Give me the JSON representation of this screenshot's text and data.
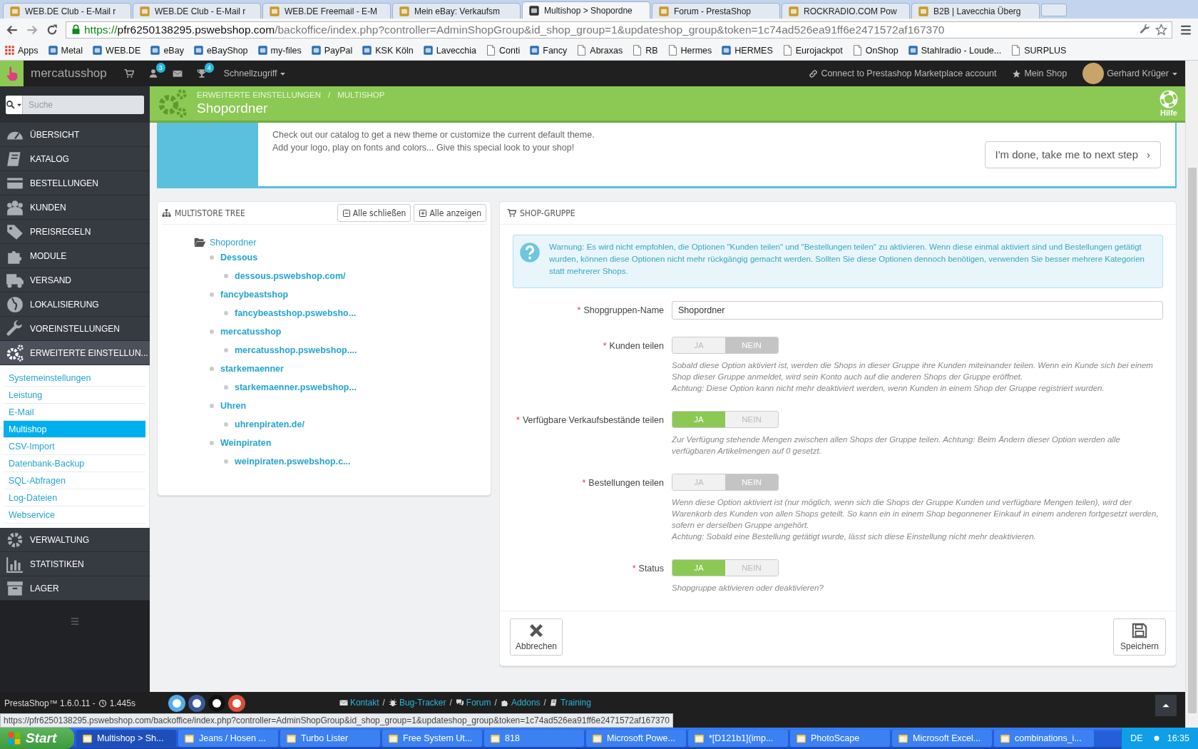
{
  "browser": {
    "tabs": [
      {
        "title": "WEB.DE Club - E-Mail r",
        "selected": false
      },
      {
        "title": "WEB.DE Club - E-Mail r",
        "selected": false
      },
      {
        "title": "WEB.DE Freemail - E-M",
        "selected": false
      },
      {
        "title": "Mein eBay: Verkaufsm",
        "selected": false
      },
      {
        "title": "Multishop > Shopordne",
        "selected": true
      },
      {
        "title": "Forum - PrestaShop",
        "selected": false
      },
      {
        "title": "ROCKRADIO.COM Pow",
        "selected": false
      },
      {
        "title": "B2B | Lavecchia Überg",
        "selected": false
      }
    ],
    "url": {
      "scheme": "https://",
      "host": "pfr6250138295.pswebshop.com",
      "path": "/backoffice/index.php?controller=AdminShopGroup&id_shop_group=1&updateshop_group&token=1c74ad526ea91ff6e2471572af167370"
    },
    "bookmarks": [
      {
        "label": "Apps",
        "kind": "apps"
      },
      {
        "label": "Metal",
        "kind": "site"
      },
      {
        "label": "WEB.DE",
        "kind": "site"
      },
      {
        "label": "eBay",
        "kind": "site"
      },
      {
        "label": "eBayShop",
        "kind": "site"
      },
      {
        "label": "my-files",
        "kind": "site"
      },
      {
        "label": "PayPal",
        "kind": "site"
      },
      {
        "label": "KSK Köln",
        "kind": "site"
      },
      {
        "label": "Lavecchia",
        "kind": "site"
      },
      {
        "label": "Conti",
        "kind": "page"
      },
      {
        "label": "Fancy",
        "kind": "site"
      },
      {
        "label": "Abraxas",
        "kind": "page"
      },
      {
        "label": "RB",
        "kind": "page"
      },
      {
        "label": "Hermes",
        "kind": "page"
      },
      {
        "label": "HERMES",
        "kind": "site"
      },
      {
        "label": "Eurojackpot",
        "kind": "page"
      },
      {
        "label": "OnShop",
        "kind": "page"
      },
      {
        "label": "Stahlradio - Loude...",
        "kind": "site"
      },
      {
        "label": "SURPLUS",
        "kind": "page"
      }
    ]
  },
  "admin_header": {
    "shop_name": "mercatusshop",
    "shortcuts": [
      {
        "kind": "cart"
      },
      {
        "kind": "user",
        "badge": "3"
      },
      {
        "kind": "envelope"
      },
      {
        "kind": "trophy",
        "badge": "4"
      }
    ],
    "quick_access": "Schnellzugriff",
    "marketplace": "Connect to Prestashop Marketplace account",
    "my_shop": "Mein Shop",
    "user": "Gerhard Krüger"
  },
  "page_header": {
    "breadcrumbs": [
      "ERWEITERTE EINSTELLUNGEN",
      "MULTISHOP"
    ],
    "separator": "/",
    "title": "Shopordner",
    "help": "Hilfe"
  },
  "sidebar": {
    "search_placeholder": "Suche",
    "items": [
      {
        "label": "ÜBERSICHT",
        "expanded": false
      },
      {
        "label": "KATALOG",
        "expanded": false
      },
      {
        "label": "BESTELLUNGEN",
        "expanded": false
      },
      {
        "label": "KUNDEN",
        "expanded": false
      },
      {
        "label": "PREISREGELN",
        "expanded": false
      },
      {
        "label": "MODULE",
        "expanded": false
      },
      {
        "label": "VERSAND",
        "expanded": false
      },
      {
        "label": "LOKALISIERUNG",
        "expanded": false
      },
      {
        "label": "VOREINSTELLUNGEN",
        "expanded": false
      },
      {
        "label": "ERWEITERTE EINSTELLUN...",
        "expanded": true,
        "children": [
          {
            "label": "Systemeinstellungen",
            "selected": false
          },
          {
            "label": "Leistung",
            "selected": false
          },
          {
            "label": "E-Mail",
            "selected": false
          },
          {
            "label": "Multishop",
            "selected": true
          },
          {
            "label": "CSV-Import",
            "selected": false
          },
          {
            "label": "Datenbank-Backup",
            "selected": false
          },
          {
            "label": "SQL-Abfragen",
            "selected": false
          },
          {
            "label": "Log-Dateien",
            "selected": false
          },
          {
            "label": "Webservice",
            "selected": false
          }
        ]
      },
      {
        "label": "VERWALTUNG",
        "expanded": false
      },
      {
        "label": "STATISTIKEN",
        "expanded": false
      },
      {
        "label": "LAGER",
        "expanded": false
      }
    ]
  },
  "onboarding": {
    "lines": [
      "Check out our catalog to get a new theme or customize the current default theme.",
      "Add your logo, play on fonts and colors... Give this special look to your shop!"
    ],
    "button": "I'm done, take me to next step",
    "button_arrow": "›"
  },
  "tree_panel": {
    "title": "MULTISTORE TREE",
    "buttons": [
      {
        "label": "Alle schließen"
      },
      {
        "label": "Alle anzeigen"
      }
    ],
    "root": {
      "label": "Shopordner",
      "children": [
        {
          "label": "Dessous",
          "children": [
            {
              "label": "dessous.pswebshop.com/"
            }
          ]
        },
        {
          "label": "fancybeastshop",
          "children": [
            {
              "label": "fancybeastshop.pswebsho..."
            }
          ]
        },
        {
          "label": "mercatusshop",
          "children": [
            {
              "label": "mercatusshop.pswebshop...."
            }
          ]
        },
        {
          "label": "starkemaenner",
          "children": [
            {
              "label": "starkemaenner.pswebshop..."
            }
          ]
        },
        {
          "label": "Uhren",
          "children": [
            {
              "label": "uhrenpiraten.de/"
            }
          ]
        },
        {
          "label": "Weinpiraten",
          "children": [
            {
              "label": "weinpiraten.pswebshop.c..."
            }
          ]
        }
      ]
    }
  },
  "form_panel": {
    "title": "SHOP-GRUPPE",
    "warning": "Warnung: Es wird nicht empfohlen, die Optionen \"Kunden teilen\" und \"Bestellungen teilen\" zu aktivieren. Wenn diese einmal aktiviert sind und Bestellungen getätigt wurden, können diese Optionen nicht mehr rückgängig gemacht werden. Sollten Sie diese Optionen dennoch benötigen, verwenden Sie besser mehrere Kategorien statt mehrerer Shops.",
    "fields": [
      {
        "kind": "text",
        "label": "Shopgruppen-Name",
        "required": true,
        "value": "Shopordner"
      },
      {
        "kind": "toggle",
        "label": "Kunden teilen",
        "required": true,
        "on": false,
        "yes": "JA",
        "no": "NEIN",
        "help": [
          "Sobald diese Option aktiviert ist, werden die Shops in dieser Gruppe ihre Kunden miteinander teilen. Wenn ein Kunde sich bei einem Shop dieser Gruppe anmeldet, wird sein Konto auch auf die anderen Shops der Gruppe eröffnet.",
          "Achtung: Diese Option kann nicht mehr deaktiviert werden, wenn Kunden in einem Shop der Gruppe registriert wurden."
        ]
      },
      {
        "kind": "toggle",
        "label": "Verfügbare Verkaufsbestände teilen",
        "required": true,
        "on": true,
        "yes": "JA",
        "no": "NEIN",
        "help": [
          "Zur Verfügung stehende Mengen zwischen allen Shops der Gruppe teilen. Achtung: Beim Ändern dieser Option werden alle verfügbaren Artikelmengen auf 0 gesetzt."
        ]
      },
      {
        "kind": "toggle",
        "label": "Bestellungen teilen",
        "required": true,
        "on": false,
        "yes": "JA",
        "no": "NEIN",
        "help": [
          "Wenn diese Option aktiviert ist (nur möglich, wenn sich die Shops der Gruppe Kunden und verfügbare Mengen teilen), wird der Warenkorb des Kunden von allen Shops geteilt. So kann ein in einem Shop begonnener Einkauf in einem anderen fortgesetzt werden, sofern er derselben Gruppe angehört.",
          "Achtung: Sobald eine Bestellung getätigt wurde, lässt sich diese Einstellung nicht mehr deaktivieren."
        ]
      },
      {
        "kind": "toggle",
        "label": "Status",
        "required": true,
        "on": true,
        "yes": "JA",
        "no": "NEIN",
        "help": [
          "Shopgruppe aktivieren oder deaktivieren?"
        ]
      }
    ],
    "required_mark": "*",
    "buttons": [
      {
        "label": "Abbrechen",
        "kind": "cancel"
      },
      {
        "label": "Speichern",
        "kind": "save"
      }
    ]
  },
  "footer": {
    "version": "PrestaShop™ 1.6.0.11 -",
    "load_time": "1.445s",
    "links": [
      {
        "label": "Kontakt",
        "separator": "/"
      },
      {
        "label": "Bug-Tracker",
        "separator": "/"
      },
      {
        "label": "Forum",
        "separator": "/"
      },
      {
        "label": "Addons",
        "separator": "/"
      },
      {
        "label": "Training"
      }
    ]
  },
  "status_url": "https://pfr6250138295.pswebshop.com/backoffice/index.php?controller=AdminShopGroup&id_shop_group=1&updateshop_group&token=1c74ad526ea91ff6e2471572af167370",
  "taskbar": {
    "start": "Start",
    "windows": [
      {
        "title": "Multishop > Sh...",
        "selected": true
      },
      {
        "title": "Jeans / Hosen ...",
        "selected": false
      },
      {
        "title": "Turbo Lister",
        "selected": false
      },
      {
        "title": "Free System Ut...",
        "selected": false
      },
      {
        "title": "818",
        "selected": false
      },
      {
        "title": "Microsoft Powe...",
        "selected": false
      },
      {
        "title": "*[D121b1](imp...",
        "selected": false
      },
      {
        "title": "PhotoScape",
        "selected": false
      },
      {
        "title": "Microsoft Excel...",
        "selected": false
      },
      {
        "title": "combinations_i...",
        "selected": false
      }
    ],
    "language": "DE",
    "clock": "16:35"
  }
}
